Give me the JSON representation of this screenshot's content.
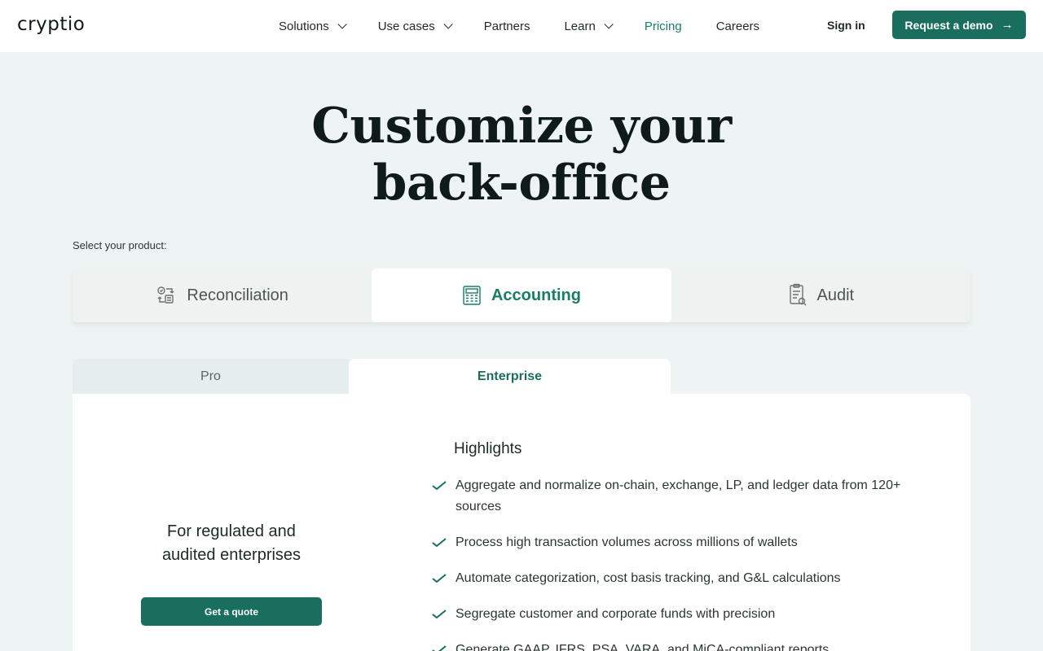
{
  "header": {
    "logo": "cryptio",
    "nav": [
      {
        "label": "Solutions",
        "dropdown": true
      },
      {
        "label": "Use cases",
        "dropdown": true
      },
      {
        "label": "Partners",
        "dropdown": false
      },
      {
        "label": "Learn",
        "dropdown": true
      },
      {
        "label": "Pricing",
        "dropdown": false,
        "active": true
      },
      {
        "label": "Careers",
        "dropdown": false
      }
    ],
    "sign_in": "Sign in",
    "demo": "Request a demo"
  },
  "hero": {
    "title_line1": "Customize your",
    "title_line2": "back-office"
  },
  "product": {
    "select_label": "Select your product:",
    "tabs": [
      {
        "label": "Reconciliation",
        "icon": "reconciliation-icon"
      },
      {
        "label": "Accounting",
        "icon": "calculator-icon",
        "active": true
      },
      {
        "label": "Audit",
        "icon": "audit-clipboard-icon"
      }
    ]
  },
  "plans": {
    "tabs": [
      {
        "label": "Pro"
      },
      {
        "label": "Enterprise",
        "active": true
      }
    ]
  },
  "card": {
    "left_title_line1": "For regulated and",
    "left_title_line2": "audited enterprises",
    "cta": "Get a quote",
    "highlights_title": "Highlights",
    "highlights": [
      "Aggregate and normalize on-chain, exchange, LP, and ledger data from 120+ sources",
      "Process high transaction volumes across millions of wallets",
      "Automate categorization, cost basis tracking, and G&L calculations",
      "Segregate customer and corporate funds with precision",
      "Generate GAAP, IFRS, PSA, VARA, and MiCA-compliant reports"
    ]
  },
  "colors": {
    "brand": "#1a6e5d",
    "accent_text": "#1a7d68",
    "page_bg": "#eef4f3"
  }
}
